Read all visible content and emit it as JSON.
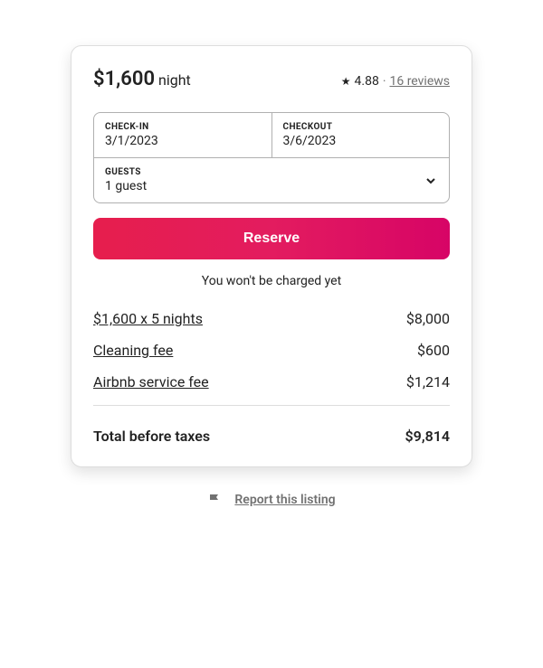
{
  "price": {
    "amount": "$1,600",
    "unit": "night"
  },
  "rating": {
    "score": "4.88",
    "reviews_text": "16 reviews"
  },
  "dates": {
    "checkin_label": "CHECK-IN",
    "checkin_value": "3/1/2023",
    "checkout_label": "CHECKOUT",
    "checkout_value": "3/6/2023"
  },
  "guests": {
    "label": "GUESTS",
    "value": "1 guest"
  },
  "reserve_label": "Reserve",
  "no_charge_text": "You won't be charged yet",
  "items": [
    {
      "label": "$1,600 x 5 nights",
      "value": "$8,000"
    },
    {
      "label": "Cleaning fee",
      "value": "$600"
    },
    {
      "label": "Airbnb service fee",
      "value": "$1,214"
    }
  ],
  "total": {
    "label": "Total before taxes",
    "value": "$9,814"
  },
  "report_text": "Report this listing"
}
